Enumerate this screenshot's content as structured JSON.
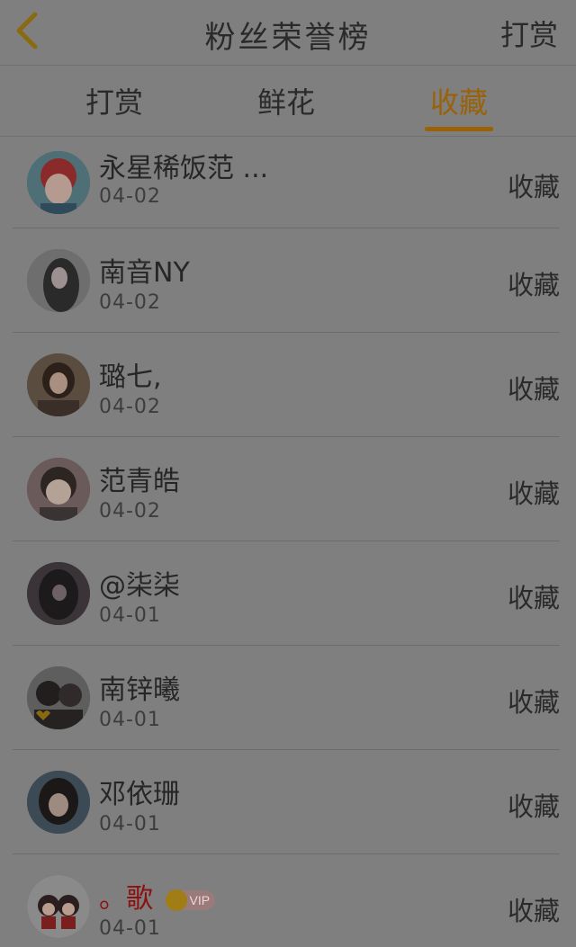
{
  "header": {
    "title": "粉丝荣誉榜",
    "right_action": "打赏"
  },
  "tabs": [
    {
      "label": "打赏"
    },
    {
      "label": "鲜花"
    },
    {
      "label": "收藏",
      "active": true
    }
  ],
  "colors": {
    "accent": "#9a6208",
    "background": "#7f7f7f"
  },
  "list": [
    {
      "name": "永星稀饭范 ...",
      "date": "04-02",
      "action": "收藏"
    },
    {
      "name": "南音NY",
      "date": "04-02",
      "action": "收藏"
    },
    {
      "name": "璐七,",
      "date": "04-02",
      "action": "收藏"
    },
    {
      "name": "范青皓",
      "date": "04-02",
      "action": "收藏"
    },
    {
      "name": "@柒柒",
      "date": "04-01",
      "action": "收藏"
    },
    {
      "name": "南锌曦",
      "date": "04-01",
      "action": "收藏"
    },
    {
      "name": "邓依珊",
      "date": "04-01",
      "action": "收藏"
    },
    {
      "name": "。歌",
      "date": "04-01",
      "action": "收藏",
      "badge": "VIP"
    }
  ]
}
